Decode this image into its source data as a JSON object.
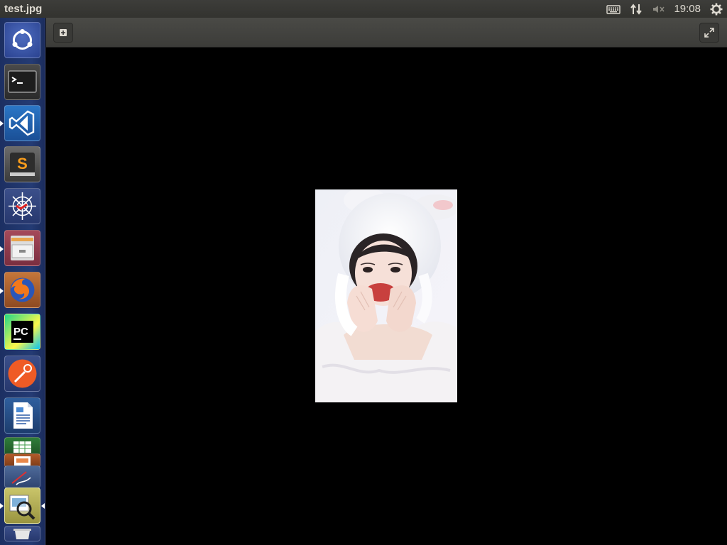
{
  "window": {
    "title": "test.jpg"
  },
  "panel": {
    "clock": "19:08",
    "indicators": [
      "keyboard-icon",
      "network-icon",
      "volume-muted-icon",
      "system-gear-icon"
    ]
  },
  "launcher": {
    "items": [
      {
        "name": "ubuntu-dash",
        "icon": "ubuntu-logo-icon",
        "running": false
      },
      {
        "name": "terminal",
        "icon": "terminal-icon",
        "running": false
      },
      {
        "name": "vscode",
        "icon": "vscode-icon",
        "running": true
      },
      {
        "name": "sublime-text",
        "icon": "sublime-icon",
        "running": false
      },
      {
        "name": "network-tool",
        "icon": "spiderweb-icon",
        "running": false
      },
      {
        "name": "file-manager",
        "icon": "file-cabinet-icon",
        "running": true
      },
      {
        "name": "firefox",
        "icon": "firefox-icon",
        "running": true
      },
      {
        "name": "pycharm",
        "icon": "pycharm-icon",
        "running": false
      },
      {
        "name": "postman",
        "icon": "postman-icon",
        "running": false
      },
      {
        "name": "libreoffice-writer",
        "icon": "writer-icon",
        "running": false
      },
      {
        "name": "libreoffice-calc",
        "icon": "calc-icon",
        "running": false
      },
      {
        "name": "libreoffice-impress",
        "icon": "impress-icon",
        "running": false
      },
      {
        "name": "draw-app",
        "icon": "draw-icon",
        "running": false
      },
      {
        "name": "image-viewer",
        "icon": "image-viewer-icon",
        "running": true
      },
      {
        "name": "trash",
        "icon": "trash-icon",
        "running": false
      }
    ]
  },
  "toolbar": {
    "left_icon": "add-icon",
    "right_icon": "fullscreen-icon"
  },
  "photo": {
    "subject": "photo-portrait-icon"
  }
}
